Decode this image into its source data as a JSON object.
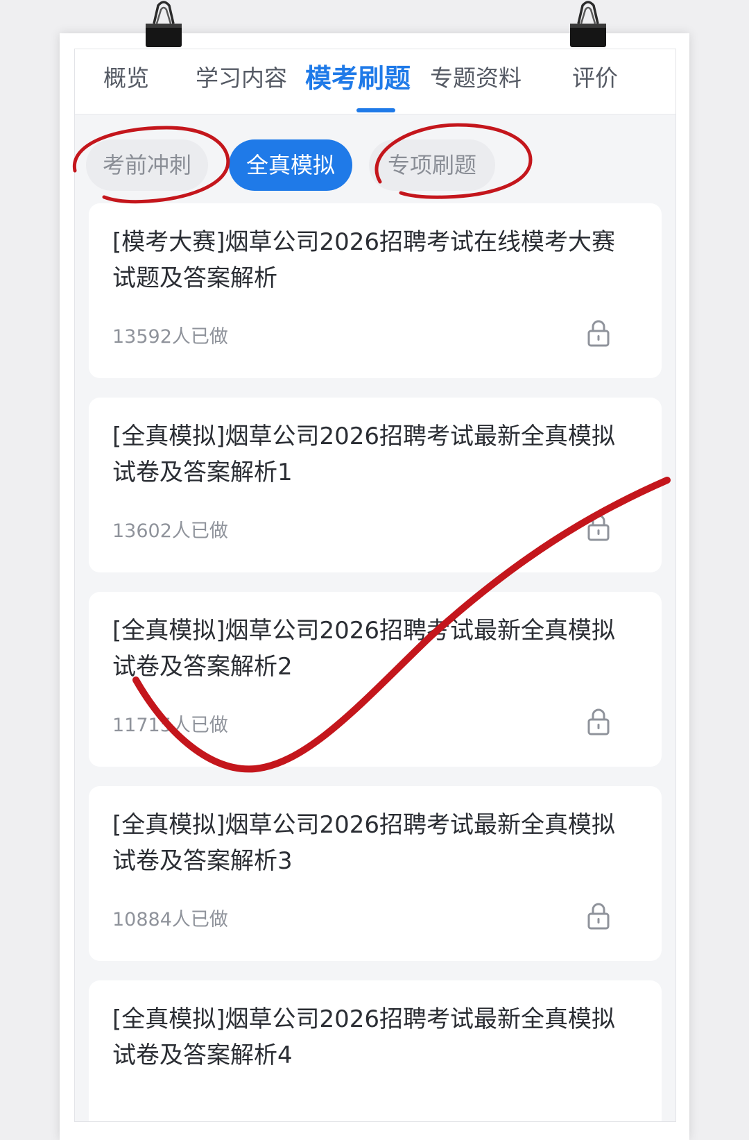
{
  "tabs": [
    {
      "label": "概览",
      "active": false
    },
    {
      "label": "学习内容",
      "active": false
    },
    {
      "label": "模考刷题",
      "active": true
    },
    {
      "label": "专题资料",
      "active": false
    },
    {
      "label": "评价",
      "active": false
    }
  ],
  "filters": [
    {
      "label": "考前冲刺",
      "selected": false
    },
    {
      "label": "全真模拟",
      "selected": true
    },
    {
      "label": "专项刷题",
      "selected": false
    }
  ],
  "papers": [
    {
      "title": "[模考大赛]烟草公司2026招聘考试在线模考大赛试题及答案解析",
      "count": "13592人已做",
      "icon": "lock-icon"
    },
    {
      "title": "[全真模拟]烟草公司2026招聘考试最新全真模拟试卷及答案解析1",
      "count": "13602人已做",
      "icon": "lock-icon"
    },
    {
      "title": "[全真模拟]烟草公司2026招聘考试最新全真模拟试卷及答案解析2",
      "count": "11715人已做",
      "icon": "lock-icon"
    },
    {
      "title": "[全真模拟]烟草公司2026招聘考试最新全真模拟试卷及答案解析3",
      "count": "10884人已做",
      "icon": "lock-icon"
    },
    {
      "title": "[全真模拟]烟草公司2026招聘考试最新全真模拟试卷及答案解析4",
      "count": "",
      "icon": "lock-icon"
    }
  ],
  "colors": {
    "accent": "#1f7ae8",
    "annotation": "#c4161c",
    "chip_inactive": "#ebecef",
    "background": "#f4f5f7"
  }
}
